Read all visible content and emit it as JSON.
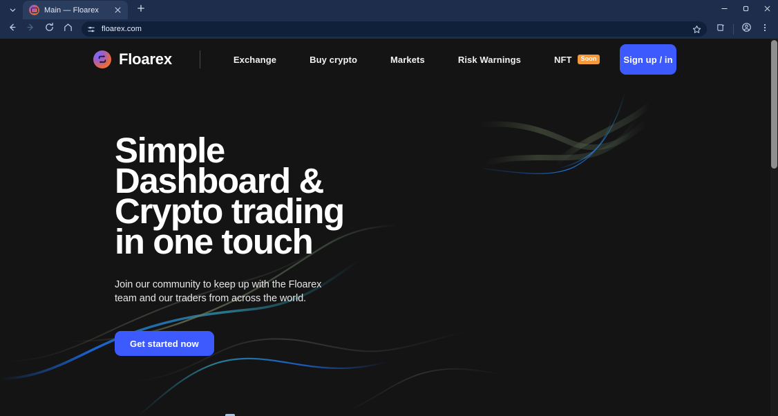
{
  "browser": {
    "tab": {
      "title": "Main — Floarex",
      "favicon_icon": "floarex-logo-icon",
      "close_icon": "close-icon"
    },
    "tab_list_icon": "chevron-down-icon",
    "new_tab_icon": "plus-icon",
    "window_controls": {
      "minimize_icon": "minimize-icon",
      "maximize_icon": "maximize-icon",
      "close_icon": "close-icon"
    },
    "toolbar": {
      "back_icon": "back-arrow-icon",
      "forward_icon": "forward-arrow-icon",
      "reload_icon": "reload-icon",
      "home_icon": "home-icon",
      "site_settings_icon": "sliders-icon",
      "url": "floarex.com",
      "url_placeholder": "Search or type URL",
      "bookmark_icon": "star-icon",
      "split_view_icon": "split-view-icon",
      "profile_icon": "account-circle-icon",
      "menu_icon": "three-dots-vertical-icon"
    }
  },
  "site": {
    "brand": {
      "name": "Floarex",
      "logo_icon": "swap-arrows-icon"
    },
    "nav": [
      {
        "label": "Exchange",
        "badge": null
      },
      {
        "label": "Buy crypto",
        "badge": null
      },
      {
        "label": "Markets",
        "badge": null
      },
      {
        "label": "Risk Warnings",
        "badge": null
      },
      {
        "label": "NFT",
        "badge": "Soon"
      }
    ],
    "signup_label": "Sign up / in",
    "hero": {
      "title_line1": "Simple",
      "title_line2": "Dashboard &",
      "title_line3": "Crypto trading",
      "title_line4": "in one touch",
      "subtitle": "Join our community to keep up with the Floarex team and our traders from across the world.",
      "cta_label": "Get started now"
    },
    "colors": {
      "background": "#141414",
      "accent_blue": "#3d5afe",
      "badge_orange": "#f59a3c",
      "text_primary": "#ffffff",
      "wave_blue": "#1c64d6",
      "wave_teal": "#2d8fa8",
      "wave_olive": "#5d6b52"
    }
  },
  "scrollbar": {
    "position_percent": 0
  }
}
